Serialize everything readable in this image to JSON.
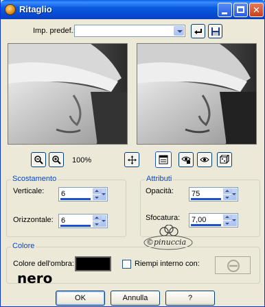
{
  "window": {
    "title": "Ritaglio"
  },
  "preset": {
    "label": "Imp. predef.:",
    "value": ""
  },
  "zoom": {
    "level": "100%"
  },
  "offset": {
    "group_title": "Scostamento",
    "vertical_label": "Verticale:",
    "vertical_value": "6",
    "horizontal_label": "Orizzontale:",
    "horizontal_value": "6"
  },
  "attributes": {
    "group_title": "Attributi",
    "opacity_label": "Opacità:",
    "opacity_value": "75",
    "blur_label": "Sfocatura:",
    "blur_value": "7,00"
  },
  "colors": {
    "group_title": "Colore",
    "shadow_label": "Colore dell'ombra:",
    "fill_label": "Riempi interno con:",
    "shadow_color": "#000000",
    "annotation": "nero"
  },
  "watermark": {
    "text": "©pinuccia"
  },
  "buttons": {
    "ok": "OK",
    "cancel": "Annulla",
    "help": "?"
  }
}
